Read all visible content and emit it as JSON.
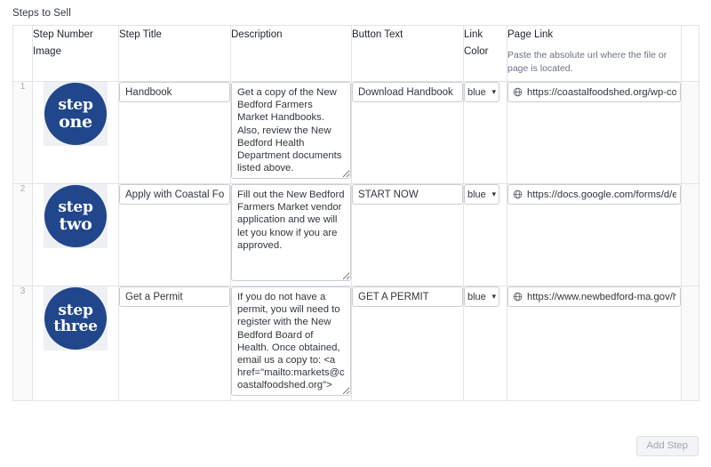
{
  "panel": {
    "title": "Steps to Sell"
  },
  "table": {
    "headers": [
      {
        "label": "",
        "help": ""
      },
      {
        "label": "Step Number Image",
        "help": ""
      },
      {
        "label": "Step Title",
        "help": ""
      },
      {
        "label": "Description",
        "help": ""
      },
      {
        "label": "Button Text",
        "help": ""
      },
      {
        "label": "Link Color",
        "help": ""
      },
      {
        "label": "Page Link",
        "help": "Paste the absolute url where the file or page is located."
      },
      {
        "label": "",
        "help": ""
      }
    ],
    "rows": [
      {
        "number": "1",
        "image_alt": "step one",
        "image_word1": "step",
        "image_word2": "one",
        "title": "Handbook",
        "description": "Get a copy of the New Bedford Farmers Market Handbooks. Also, review the New Bedford Health Department documents listed above.",
        "button_text": "Download Handbook",
        "link_color": "blue",
        "page_link": "https://coastalfoodshed.org/wp-co"
      },
      {
        "number": "2",
        "image_alt": "step two",
        "image_word1": "step",
        "image_word2": "two",
        "title": "Apply with Coastal Fo",
        "description": "Fill out the New Bedford Farmers Market vendor application and we will let you know if you are approved.",
        "button_text": "START NOW",
        "link_color": "blue",
        "page_link": "https://docs.google.com/forms/d/e"
      },
      {
        "number": "3",
        "image_alt": "step three",
        "image_word1": "step",
        "image_word2": "three",
        "title": "Get a Permit",
        "description": "If you do not have a permit, you will need to register with the New Bedford Board of Health. Once obtained, email us a copy to: <a href=\"mailto:markets@coastalfoodshed.org\">",
        "button_text": "GET A PERMIT",
        "link_color": "blue",
        "page_link": "https://www.newbedford-ma.gov/h"
      }
    ]
  },
  "footer": {
    "add_step_label": "Add Step"
  },
  "colors": {
    "step_circle": "#21468b",
    "border": "#e2e4e7",
    "input_border": "#c9ccd1",
    "help_text": "#6a7382",
    "row_number_bg": "#fafafa"
  },
  "icons": {
    "globe": "globe-icon",
    "chevron_down": "chevron-down-icon"
  }
}
